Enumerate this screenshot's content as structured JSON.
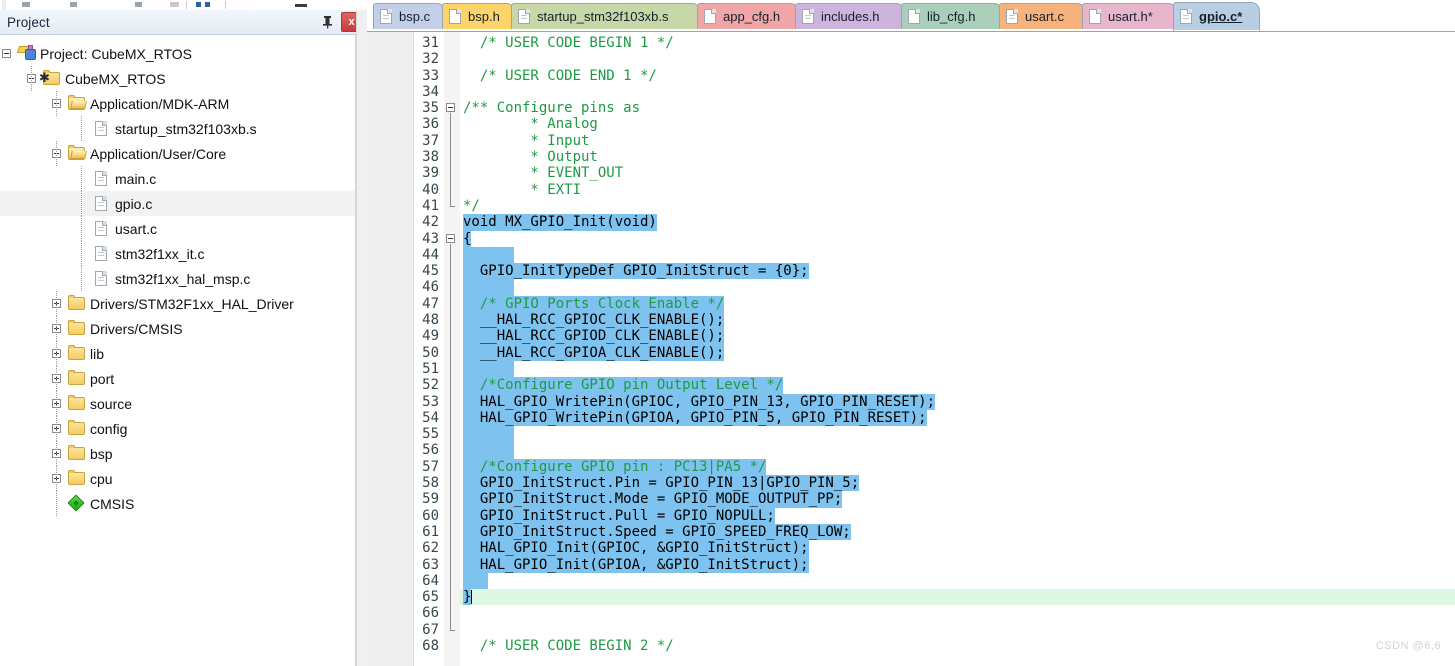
{
  "window": {
    "toolbar_present": true
  },
  "project_panel": {
    "title": "Project",
    "pin_icon": "pin-icon",
    "close_label": "x",
    "tree": [
      {
        "label": "Project: CubeMX_RTOS",
        "icon": "project-icon",
        "depth": 0,
        "state": "expanded",
        "selected": false
      },
      {
        "label": "CubeMX_RTOS",
        "icon": "target-icon",
        "depth": 1,
        "state": "expanded",
        "selected": false
      },
      {
        "label": "Application/MDK-ARM",
        "icon": "folder-open-icon",
        "depth": 2,
        "state": "expanded",
        "selected": false
      },
      {
        "label": "startup_stm32f103xb.s",
        "icon": "file-icon",
        "depth": 3,
        "state": "leaf",
        "selected": false
      },
      {
        "label": "Application/User/Core",
        "icon": "folder-open-icon",
        "depth": 2,
        "state": "expanded",
        "selected": false
      },
      {
        "label": "main.c",
        "icon": "file-icon",
        "depth": 3,
        "state": "leaf",
        "selected": false
      },
      {
        "label": "gpio.c",
        "icon": "file-icon",
        "depth": 3,
        "state": "leaf",
        "selected": true
      },
      {
        "label": "usart.c",
        "icon": "file-icon",
        "depth": 3,
        "state": "leaf",
        "selected": false
      },
      {
        "label": "stm32f1xx_it.c",
        "icon": "file-icon",
        "depth": 3,
        "state": "leaf",
        "selected": false
      },
      {
        "label": "stm32f1xx_hal_msp.c",
        "icon": "file-icon",
        "depth": 3,
        "state": "leaf",
        "selected": false
      },
      {
        "label": "Drivers/STM32F1xx_HAL_Driver",
        "icon": "folder-icon",
        "depth": 2,
        "state": "collapsed",
        "selected": false
      },
      {
        "label": "Drivers/CMSIS",
        "icon": "folder-icon",
        "depth": 2,
        "state": "collapsed",
        "selected": false
      },
      {
        "label": "lib",
        "icon": "folder-icon",
        "depth": 2,
        "state": "collapsed",
        "selected": false
      },
      {
        "label": "port",
        "icon": "folder-icon",
        "depth": 2,
        "state": "collapsed",
        "selected": false
      },
      {
        "label": "source",
        "icon": "folder-icon",
        "depth": 2,
        "state": "collapsed",
        "selected": false
      },
      {
        "label": "config",
        "icon": "folder-icon",
        "depth": 2,
        "state": "collapsed",
        "selected": false
      },
      {
        "label": "bsp",
        "icon": "folder-icon",
        "depth": 2,
        "state": "collapsed",
        "selected": false
      },
      {
        "label": "cpu",
        "icon": "folder-icon",
        "depth": 2,
        "state": "collapsed",
        "selected": false
      },
      {
        "label": "CMSIS",
        "icon": "cmsis-icon",
        "depth": 2,
        "state": "leaf",
        "selected": false
      }
    ]
  },
  "editor": {
    "tabs": [
      {
        "label": "bsp.c",
        "color": "#c3cfe6",
        "active": false,
        "icon": "file-icon"
      },
      {
        "label": "bsp.h",
        "color": "#fdd46a",
        "active": false,
        "icon": "file-icon"
      },
      {
        "label": "startup_stm32f103xb.s",
        "color": "#c8d7a8",
        "active": false,
        "icon": "file-icon"
      },
      {
        "label": "app_cfg.h",
        "color": "#f0a6a6",
        "active": false,
        "icon": "file-icon"
      },
      {
        "label": "includes.h",
        "color": "#cdb4dc",
        "active": false,
        "icon": "file-icon"
      },
      {
        "label": "lib_cfg.h",
        "color": "#a9cfbb",
        "active": false,
        "icon": "file-icon"
      },
      {
        "label": "usart.c",
        "color": "#f6b27a",
        "active": false,
        "icon": "file-icon"
      },
      {
        "label": "usart.h*",
        "color": "#e8b6cc",
        "active": false,
        "icon": "file-icon"
      },
      {
        "label": "gpio.c*",
        "color": "#b8cfe3",
        "active": true,
        "icon": "file-icon"
      }
    ],
    "colors": {
      "selection": "#7ec3ef",
      "current_line": "#ddf8e2",
      "comment": "#1e9a44",
      "text": "#000000"
    },
    "first_visible_line": 31,
    "lines": [
      {
        "n": 31,
        "text": "  /* USER CODE BEGIN 1 */",
        "kind": "comment",
        "sel": false
      },
      {
        "n": 32,
        "text": "",
        "kind": "code",
        "sel": false
      },
      {
        "n": 33,
        "text": "  /* USER CODE END 1 */",
        "kind": "comment",
        "sel": false
      },
      {
        "n": 34,
        "text": "",
        "kind": "code",
        "sel": false
      },
      {
        "n": 35,
        "text": "/** Configure pins as",
        "kind": "comment",
        "sel": false
      },
      {
        "n": 36,
        "text": "        * Analog",
        "kind": "comment",
        "sel": false
      },
      {
        "n": 37,
        "text": "        * Input",
        "kind": "comment",
        "sel": false
      },
      {
        "n": 38,
        "text": "        * Output",
        "kind": "comment",
        "sel": false
      },
      {
        "n": 39,
        "text": "        * EVENT_OUT",
        "kind": "comment",
        "sel": false
      },
      {
        "n": 40,
        "text": "        * EXTI",
        "kind": "comment",
        "sel": false
      },
      {
        "n": 41,
        "text": "*/",
        "kind": "comment",
        "sel": false
      },
      {
        "n": 42,
        "text": "void MX_GPIO_Init(void)",
        "kind": "code",
        "sel": true
      },
      {
        "n": 43,
        "text": "{",
        "kind": "code",
        "sel": true
      },
      {
        "n": 44,
        "text": "",
        "kind": "code",
        "sel": true
      },
      {
        "n": 45,
        "text": "  GPIO_InitTypeDef GPIO_InitStruct = {0};",
        "kind": "code",
        "sel": true
      },
      {
        "n": 46,
        "text": "",
        "kind": "code",
        "sel": true
      },
      {
        "n": 47,
        "text": "  /* GPIO Ports Clock Enable */",
        "kind": "comment",
        "sel": true
      },
      {
        "n": 48,
        "text": "  __HAL_RCC_GPIOC_CLK_ENABLE();",
        "kind": "code",
        "sel": true
      },
      {
        "n": 49,
        "text": "  __HAL_RCC_GPIOD_CLK_ENABLE();",
        "kind": "code",
        "sel": true
      },
      {
        "n": 50,
        "text": "  __HAL_RCC_GPIOA_CLK_ENABLE();",
        "kind": "code",
        "sel": true
      },
      {
        "n": 51,
        "text": "",
        "kind": "code",
        "sel": true
      },
      {
        "n": 52,
        "text": "  /*Configure GPIO pin Output Level */",
        "kind": "comment",
        "sel": true
      },
      {
        "n": 53,
        "text": "  HAL_GPIO_WritePin(GPIOC, GPIO_PIN_13, GPIO_PIN_RESET);",
        "kind": "code",
        "sel": true
      },
      {
        "n": 54,
        "text": "  HAL_GPIO_WritePin(GPIOA, GPIO_PIN_5, GPIO_PIN_RESET);",
        "kind": "code",
        "sel": true
      },
      {
        "n": 55,
        "text": "",
        "kind": "code",
        "sel": true
      },
      {
        "n": 56,
        "text": "",
        "kind": "code",
        "sel": true
      },
      {
        "n": 57,
        "text": "  /*Configure GPIO pin : PC13|PA5 */",
        "kind": "comment",
        "sel": true
      },
      {
        "n": 58,
        "text": "  GPIO_InitStruct.Pin = GPIO_PIN_13|GPIO_PIN_5;",
        "kind": "code",
        "sel": true
      },
      {
        "n": 59,
        "text": "  GPIO_InitStruct.Mode = GPIO_MODE_OUTPUT_PP;",
        "kind": "code",
        "sel": true
      },
      {
        "n": 60,
        "text": "  GPIO_InitStruct.Pull = GPIO_NOPULL;",
        "kind": "code",
        "sel": true
      },
      {
        "n": 61,
        "text": "  GPIO_InitStruct.Speed = GPIO_SPEED_FREQ_LOW;",
        "kind": "code",
        "sel": true
      },
      {
        "n": 62,
        "text": "  HAL_GPIO_Init(GPIOC, &GPIO_InitStruct);",
        "kind": "code",
        "sel": true
      },
      {
        "n": 63,
        "text": "  HAL_GPIO_Init(GPIOA, &GPIO_InitStruct);",
        "kind": "code",
        "sel": true
      },
      {
        "n": 64,
        "text": "",
        "kind": "code",
        "sel": true
      },
      {
        "n": 65,
        "text": "}",
        "kind": "code",
        "sel": true,
        "current": true
      },
      {
        "n": 66,
        "text": "",
        "kind": "code",
        "sel": false
      },
      {
        "n": 67,
        "text": "",
        "kind": "code",
        "sel": false
      },
      {
        "n": 68,
        "text": "  /* USER CODE BEGIN 2 */",
        "kind": "comment",
        "sel": false
      }
    ]
  },
  "watermark": {
    "text": "CSDN @6,6"
  }
}
